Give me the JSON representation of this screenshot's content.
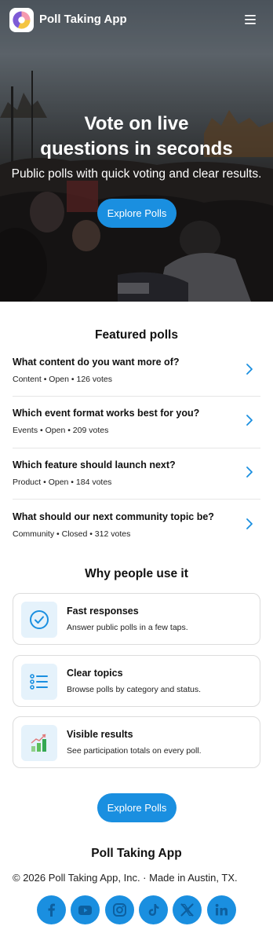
{
  "header": {
    "app_name": "Poll Taking App",
    "logo": "app-logo-icon",
    "menu_icon": "hamburger-menu-icon"
  },
  "hero": {
    "title_line1": "Vote on live",
    "title_line2": "questions in seconds",
    "subtitle": "Public polls with quick voting and clear results.",
    "cta_label": "Explore Polls"
  },
  "featured": {
    "title": "Featured polls",
    "polls": [
      {
        "question": "What content do you want more of?",
        "meta": "Content • Open • 126 votes"
      },
      {
        "question": "Which event format works best for you?",
        "meta": "Events • Open • 209 votes"
      },
      {
        "question": "Which feature should launch next?",
        "meta": "Product • Open • 184 votes"
      },
      {
        "question": "What should our next community topic be?",
        "meta": "Community • Closed • 312 votes"
      }
    ]
  },
  "why": {
    "title": "Why people use it",
    "cards": [
      {
        "title": "Fast responses",
        "description": "Answer public polls in a few taps.",
        "icon": "check-circle-icon"
      },
      {
        "title": "Clear topics",
        "description": "Browse polls by category and status.",
        "icon": "list-icon"
      },
      {
        "title": "Visible results",
        "description": "See participation totals on every poll.",
        "icon": "bar-chart-icon"
      }
    ]
  },
  "footer": {
    "cta_label": "Explore Polls",
    "name": "Poll Taking App",
    "copyright": "© 2026 Poll Taking App, Inc. · Made in Austin, TX.",
    "social": [
      "facebook-icon",
      "youtube-icon",
      "instagram-icon",
      "tiktok-icon",
      "x-icon",
      "linkedin-icon"
    ]
  },
  "colors": {
    "accent": "#1a8fe0",
    "icon_bg": "#e5f2fb",
    "card_border": "#dcdcdc"
  }
}
